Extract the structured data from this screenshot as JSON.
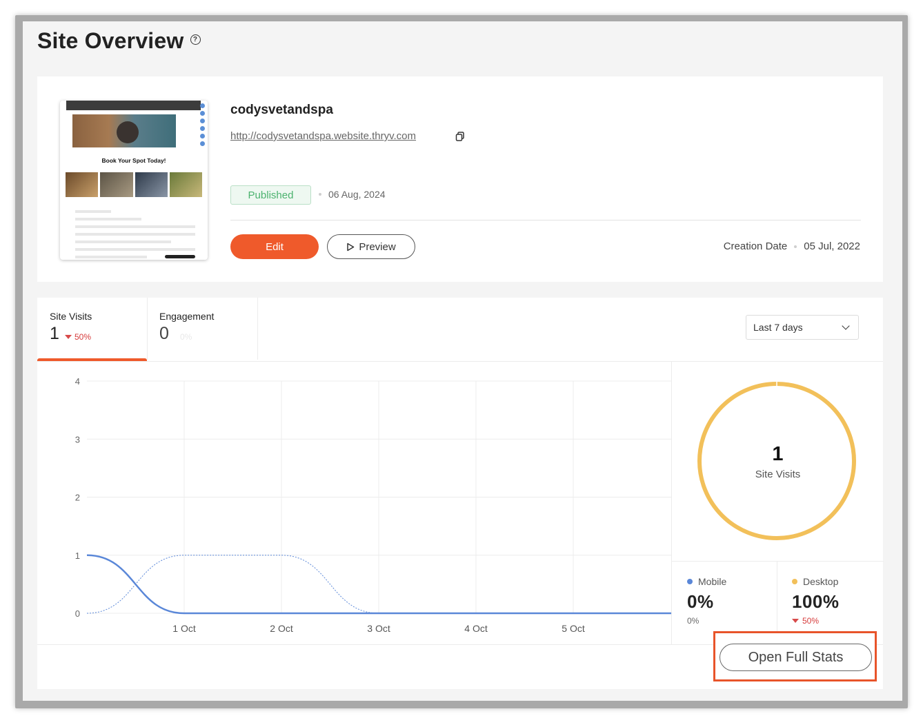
{
  "page": {
    "title": "Site Overview",
    "help_icon": "help-circle-icon"
  },
  "site": {
    "name": "codysvetandspa",
    "url": "http://codysvetandspa.website.thryv.com",
    "status": "Published",
    "status_date": "06 Aug, 2024",
    "creation_label": "Creation Date",
    "creation_date": "05 Jul, 2022",
    "thumbnail": {
      "headline": "Book Your Spot Today!"
    }
  },
  "actions": {
    "edit_label": "Edit",
    "preview_label": "Preview",
    "open_full_stats_label": "Open Full Stats"
  },
  "stats": {
    "tabs": [
      {
        "label": "Site Visits",
        "value": "1",
        "change": "50%",
        "direction": "down",
        "active": true
      },
      {
        "label": "Engagement",
        "value": "0",
        "change": "0%",
        "active": false
      }
    ],
    "range": {
      "selected": "Last 7 days"
    },
    "donut": {
      "value": "1",
      "label": "Site Visits",
      "color": "#f2c05a"
    },
    "breakdown": [
      {
        "name": "Mobile",
        "pct": "0%",
        "sub": "0%",
        "color": "#5a87d8"
      },
      {
        "name": "Desktop",
        "pct": "100%",
        "sub": "50%",
        "color": "#f2c05a",
        "direction": "down"
      }
    ]
  },
  "colors": {
    "accent": "#ef5a2b",
    "series_primary": "#5a87d8",
    "published_green": "#4bb26e",
    "negative_red": "#d63b3b"
  },
  "chart_data": {
    "type": "line",
    "x_tick_labels": [
      "1 Oct",
      "2 Oct",
      "3 Oct",
      "4 Oct",
      "5 Oct"
    ],
    "ylim": [
      0,
      4
    ],
    "y_ticks": [
      0,
      1,
      2,
      3,
      4
    ],
    "grid": true,
    "series": [
      {
        "style": "solid",
        "x": [
          0,
          1,
          2,
          3,
          4,
          5,
          6
        ],
        "values": [
          1,
          0,
          0,
          0,
          0,
          0,
          0
        ],
        "color": "#5a87d8"
      },
      {
        "style": "dotted",
        "x": [
          0,
          1,
          2,
          3
        ],
        "values": [
          0,
          1,
          1,
          0
        ],
        "color": "#5a87d8"
      }
    ]
  }
}
